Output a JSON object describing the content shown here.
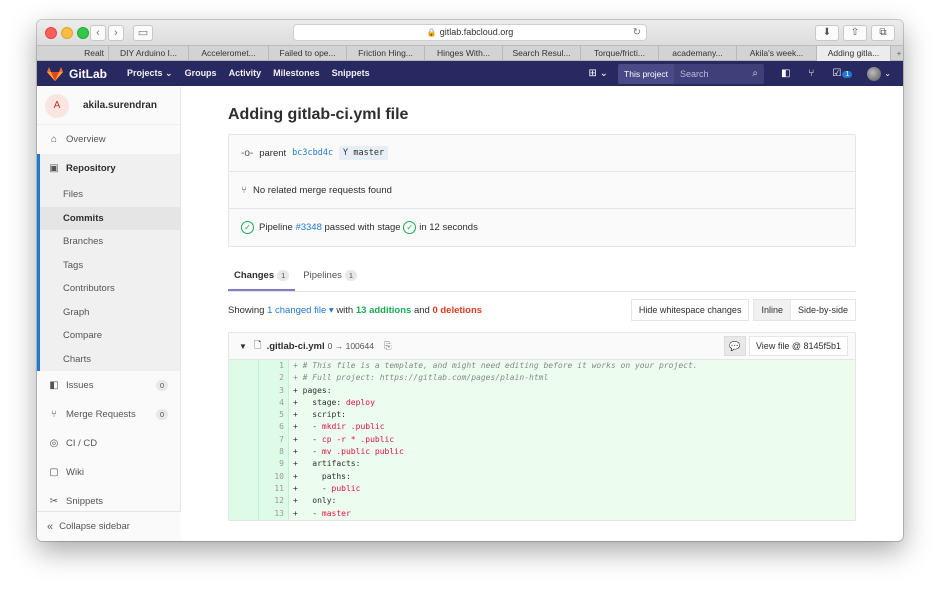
{
  "browser": {
    "url": "gitlab.fabcloud.org",
    "tabs": [
      "Realt",
      "DIY Arduino I...",
      "Acceleromet...",
      "Failed to ope...",
      "Friction Hing...",
      "Hinges With...",
      "Search Resul...",
      "Torque/fricti...",
      "academany...",
      "Akila's week...",
      "Adding gitla..."
    ],
    "active_tab": 10,
    "new_tab": "+"
  },
  "header": {
    "brand": "GitLab",
    "nav": [
      "Projects ⌄",
      "Groups",
      "Activity",
      "Milestones",
      "Snippets"
    ],
    "this_project": "This project",
    "search_placeholder": "Search",
    "todo_count": "1",
    "brand_color": "#292961"
  },
  "sidebar": {
    "avatar_letter": "A",
    "username": "akila.surendran",
    "overview": "Overview",
    "repository": "Repository",
    "repo_items": [
      "Files",
      "Commits",
      "Branches",
      "Tags",
      "Contributors",
      "Graph",
      "Compare",
      "Charts"
    ],
    "active_repo_item": 1,
    "issues": "Issues",
    "issues_count": "0",
    "merge_requests": "Merge Requests",
    "mr_count": "0",
    "cicd": "CI / CD",
    "wiki": "Wiki",
    "snippets": "Snippets",
    "collapse": "Collapse sidebar"
  },
  "commit": {
    "title": "Adding gitlab-ci.yml file",
    "parent_label": "parent",
    "parent_sha": "bc3cbd4c",
    "branch": "master",
    "merge_requests_text": "No related merge requests found",
    "pipeline_label": "Pipeline",
    "pipeline_id": "#3348",
    "pipeline_status_text": "passed with stage",
    "pipeline_duration": "in 12 seconds"
  },
  "tabs": {
    "changes": "Changes",
    "changes_count": "1",
    "pipelines": "Pipelines",
    "pipelines_count": "1"
  },
  "stats": {
    "showing": "Showing",
    "changed_files": "1 changed file ▾",
    "with": "with",
    "additions": "13 additions",
    "and": "and",
    "deletions": "0 deletions",
    "hide_whitespace": "Hide whitespace changes",
    "inline": "Inline",
    "side_by_side": "Side-by-side"
  },
  "file": {
    "name": ".gitlab-ci.yml",
    "mode": "0 → 100644",
    "view_file": "View file @ 8145f5b1",
    "lines": [
      {
        "n": "1",
        "text": "+ # This file is a template, and might need editing before it works on your project.",
        "kind": "comment"
      },
      {
        "n": "2",
        "text": "+ # Full project: https://gitlab.com/pages/plain-html",
        "kind": "comment"
      },
      {
        "n": "3",
        "text": "+ pages:",
        "kind": "key"
      },
      {
        "n": "4",
        "text": "+   stage: ",
        "val": "deploy",
        "kind": "kv"
      },
      {
        "n": "5",
        "text": "+   script:",
        "kind": "key"
      },
      {
        "n": "6",
        "text": "+   - ",
        "val": "mkdir .public",
        "kind": "kv"
      },
      {
        "n": "7",
        "text": "+   - ",
        "val": "cp -r * .public",
        "kind": "kv"
      },
      {
        "n": "8",
        "text": "+   - ",
        "val": "mv .public public",
        "kind": "kv"
      },
      {
        "n": "9",
        "text": "+   artifacts:",
        "kind": "key"
      },
      {
        "n": "10",
        "text": "+     paths:",
        "kind": "key"
      },
      {
        "n": "11",
        "text": "+     - ",
        "val": "public",
        "kind": "kv"
      },
      {
        "n": "12",
        "text": "+   only:",
        "kind": "key"
      },
      {
        "n": "13",
        "text": "+   - ",
        "val": "master",
        "kind": "kv"
      }
    ]
  }
}
